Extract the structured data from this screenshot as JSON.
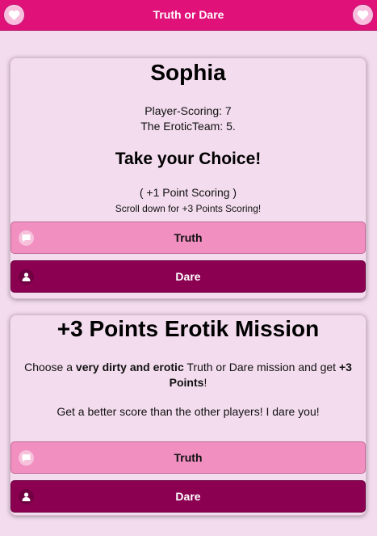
{
  "app": {
    "title": "Truth or Dare",
    "accent_color": "#e0127a",
    "left_icon": "heart-icon",
    "right_icon": "heart-icon"
  },
  "scoring": {
    "player_name": "Sophia",
    "player_score_line": "Player-Scoring: 7",
    "team_score_line": "The EroticTeam: 5.",
    "choice_heading": "Take your Choice!",
    "point_scoring": "( +1 Point Scoring )",
    "scroll_hint": "Scroll down for +3 Points Scoring!",
    "truth_label": "Truth",
    "truth_icon": "speech-bubble-icon",
    "dare_label": "Dare",
    "dare_icon": "person-icon"
  },
  "mission": {
    "title": "+3 Points Erotik Mission",
    "text_before": "Choose a ",
    "text_bold_1": "very dirty and erotic",
    "text_middle": " Truth or Dare mission and get ",
    "text_bold_2": "+3 Points",
    "text_after": "!",
    "dare_text": "Get a better score than the other players! I dare you!",
    "truth_label": "Truth",
    "truth_icon": "speech-bubble-icon",
    "dare_label": "Dare",
    "dare_icon": "person-icon"
  }
}
